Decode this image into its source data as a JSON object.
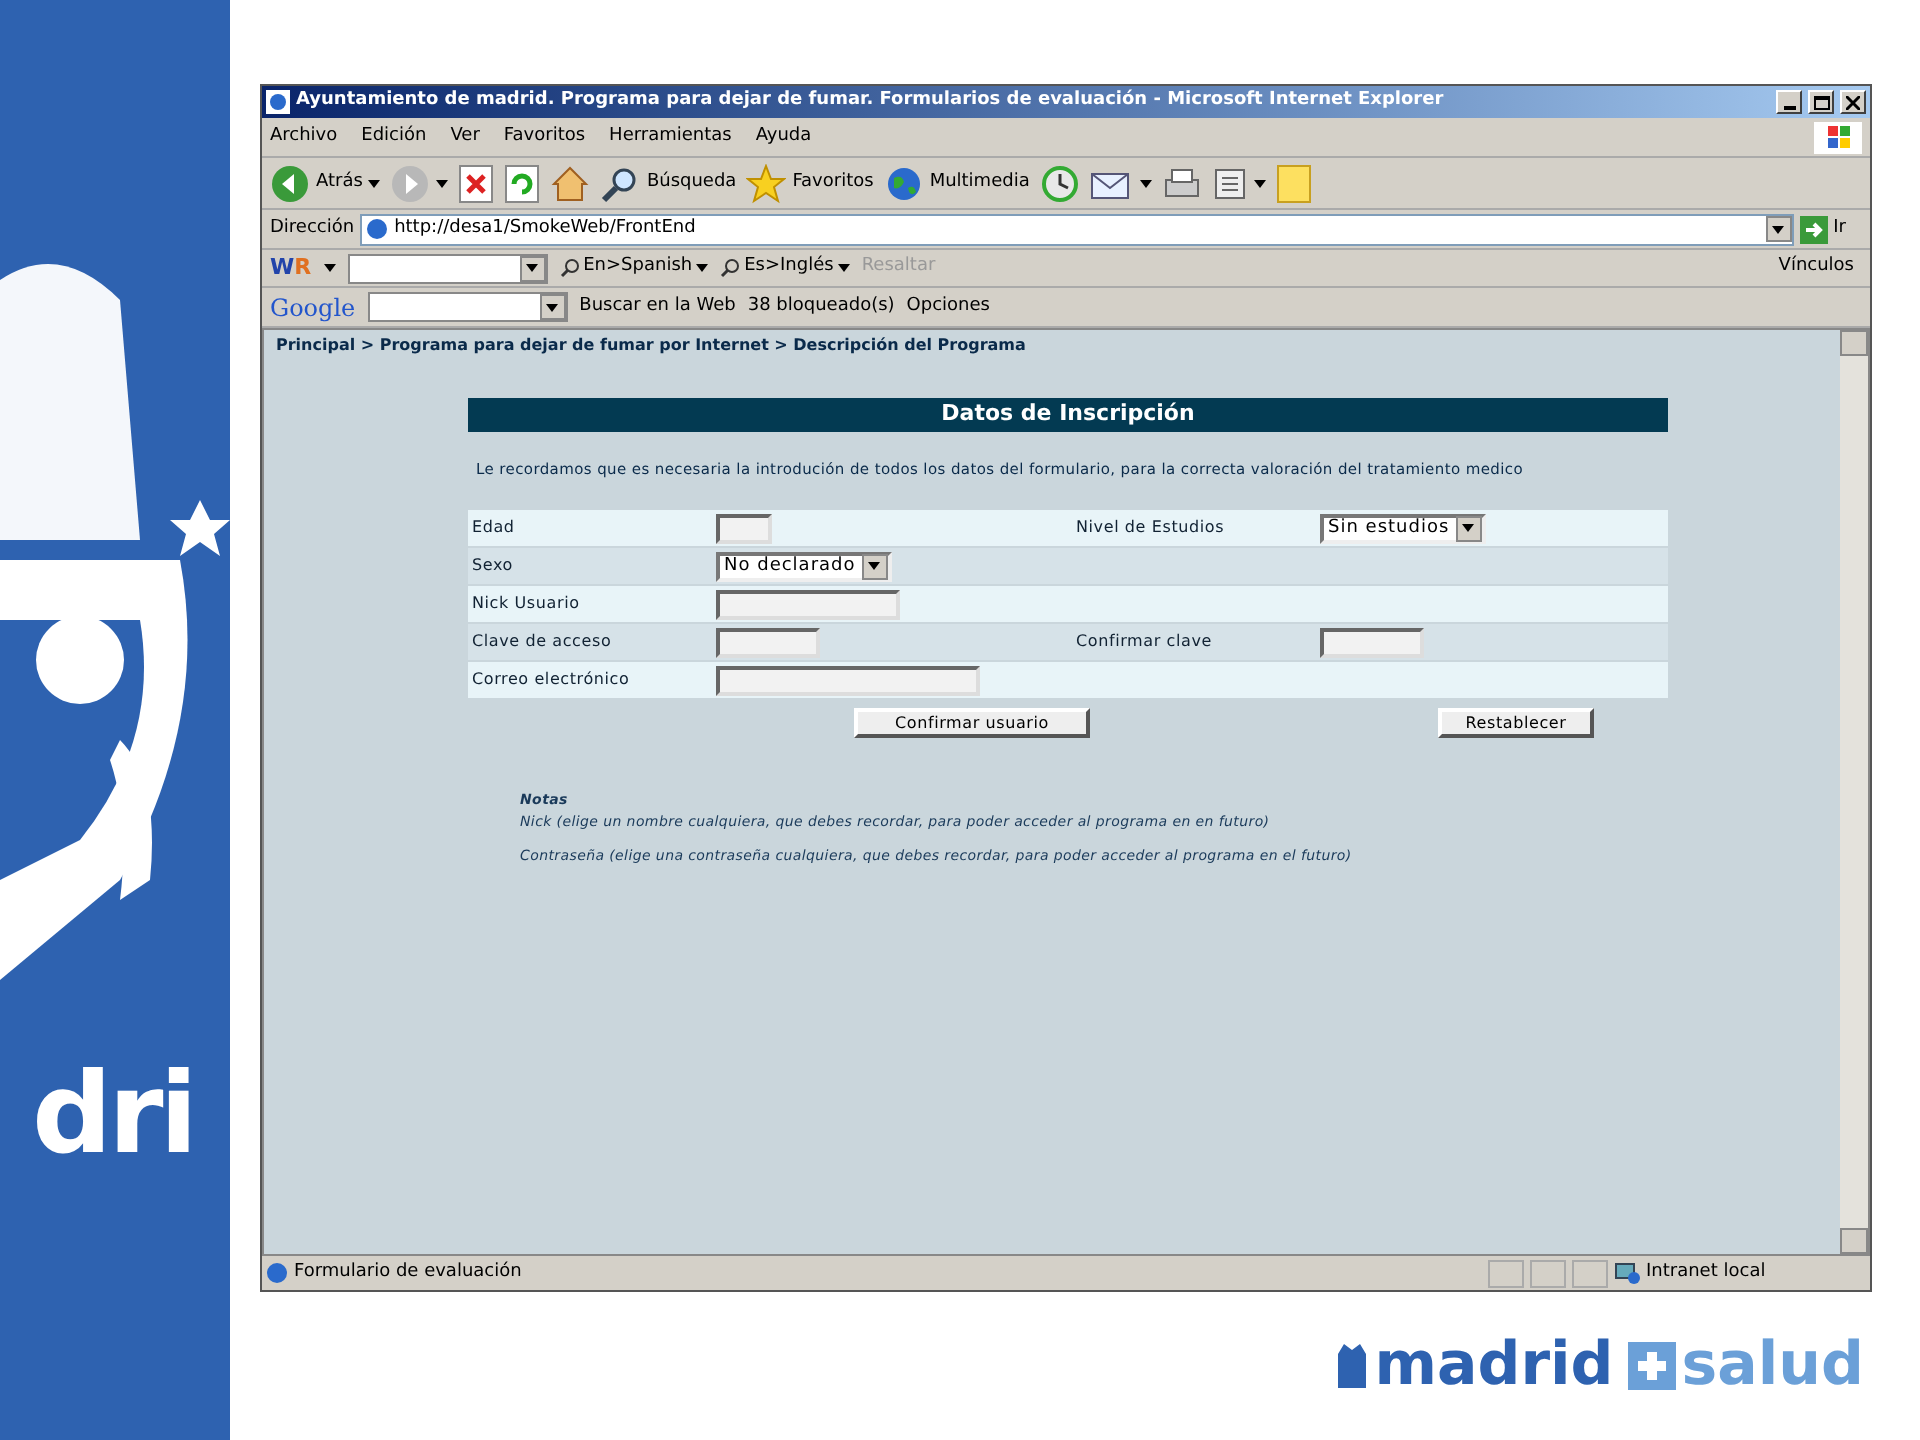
{
  "slide": {
    "logo_text": "dri",
    "footer_logo": {
      "left": "madrid",
      "right": "salud"
    }
  },
  "window": {
    "title": "Ayuntamiento de madrid. Programa para dejar de fumar. Formularios de evaluación - Microsoft Internet Explorer"
  },
  "menu": [
    "Archivo",
    "Edición",
    "Ver",
    "Favoritos",
    "Herramientas",
    "Ayuda"
  ],
  "toolbar": [
    {
      "kind": "back",
      "label": "Atrás"
    },
    {
      "kind": "forward"
    },
    {
      "kind": "stop"
    },
    {
      "kind": "refresh"
    },
    {
      "kind": "home"
    },
    {
      "kind": "search",
      "label": "Búsqueda"
    },
    {
      "kind": "favorites",
      "label": "Favoritos"
    },
    {
      "kind": "media",
      "label": "Multimedia"
    },
    {
      "kind": "history"
    },
    {
      "kind": "mail"
    },
    {
      "kind": "print"
    },
    {
      "kind": "edit"
    },
    {
      "kind": "note"
    }
  ],
  "address": {
    "label": "Dirección",
    "value": "http://desa1/SmokeWeb/FrontEnd",
    "go": "Ir"
  },
  "wr_bar": {
    "logo": [
      "W",
      "R"
    ],
    "items": [
      "En>Spanish",
      "Es>Inglés"
    ],
    "disabled_item": "Resaltar",
    "links": "Vínculos"
  },
  "google_bar": {
    "logo": "Google",
    "search": "Buscar en la Web",
    "blocked": "38 bloqueado(s)",
    "options": "Opciones"
  },
  "breadcrumb": "Principal > Programa para dejar de fumar por Internet > Descripción del Programa",
  "heading": "Datos de Inscripción",
  "intro": "Le recordamos que es necesaria la introdución de todos los datos del formulario, para la correcta valoración del tratamiento medico",
  "form_rows": [
    {
      "fields": [
        {
          "label": "Edad",
          "kind": "text"
        },
        {
          "label": "Nivel de Estudios",
          "kind": "select",
          "value": "Sin estudios"
        }
      ]
    },
    {
      "fields": [
        {
          "label": "Sexo",
          "kind": "select",
          "value": "No declarado"
        }
      ]
    },
    {
      "fields": [
        {
          "label": "Nick Usuario",
          "kind": "text"
        }
      ]
    },
    {
      "fields": [
        {
          "label": "Clave de acceso",
          "kind": "text"
        },
        {
          "label": "Confirmar clave",
          "kind": "text"
        }
      ]
    },
    {
      "fields": [
        {
          "label": "Correo electrónico",
          "kind": "text"
        }
      ]
    }
  ],
  "buttons": [
    "Confirmar usuario",
    "Restablecer"
  ],
  "notes": {
    "title": "Notas",
    "lines": [
      "Nick (elige un nombre cualquiera, que debes recordar, para poder acceder al programa en en futuro)",
      "Contraseña (elige una contraseña cualquiera, que debes recordar, para poder acceder al programa en el futuro)"
    ]
  },
  "status_bar": {
    "text": "Formulario de evaluación",
    "zone": "Intranet local"
  }
}
